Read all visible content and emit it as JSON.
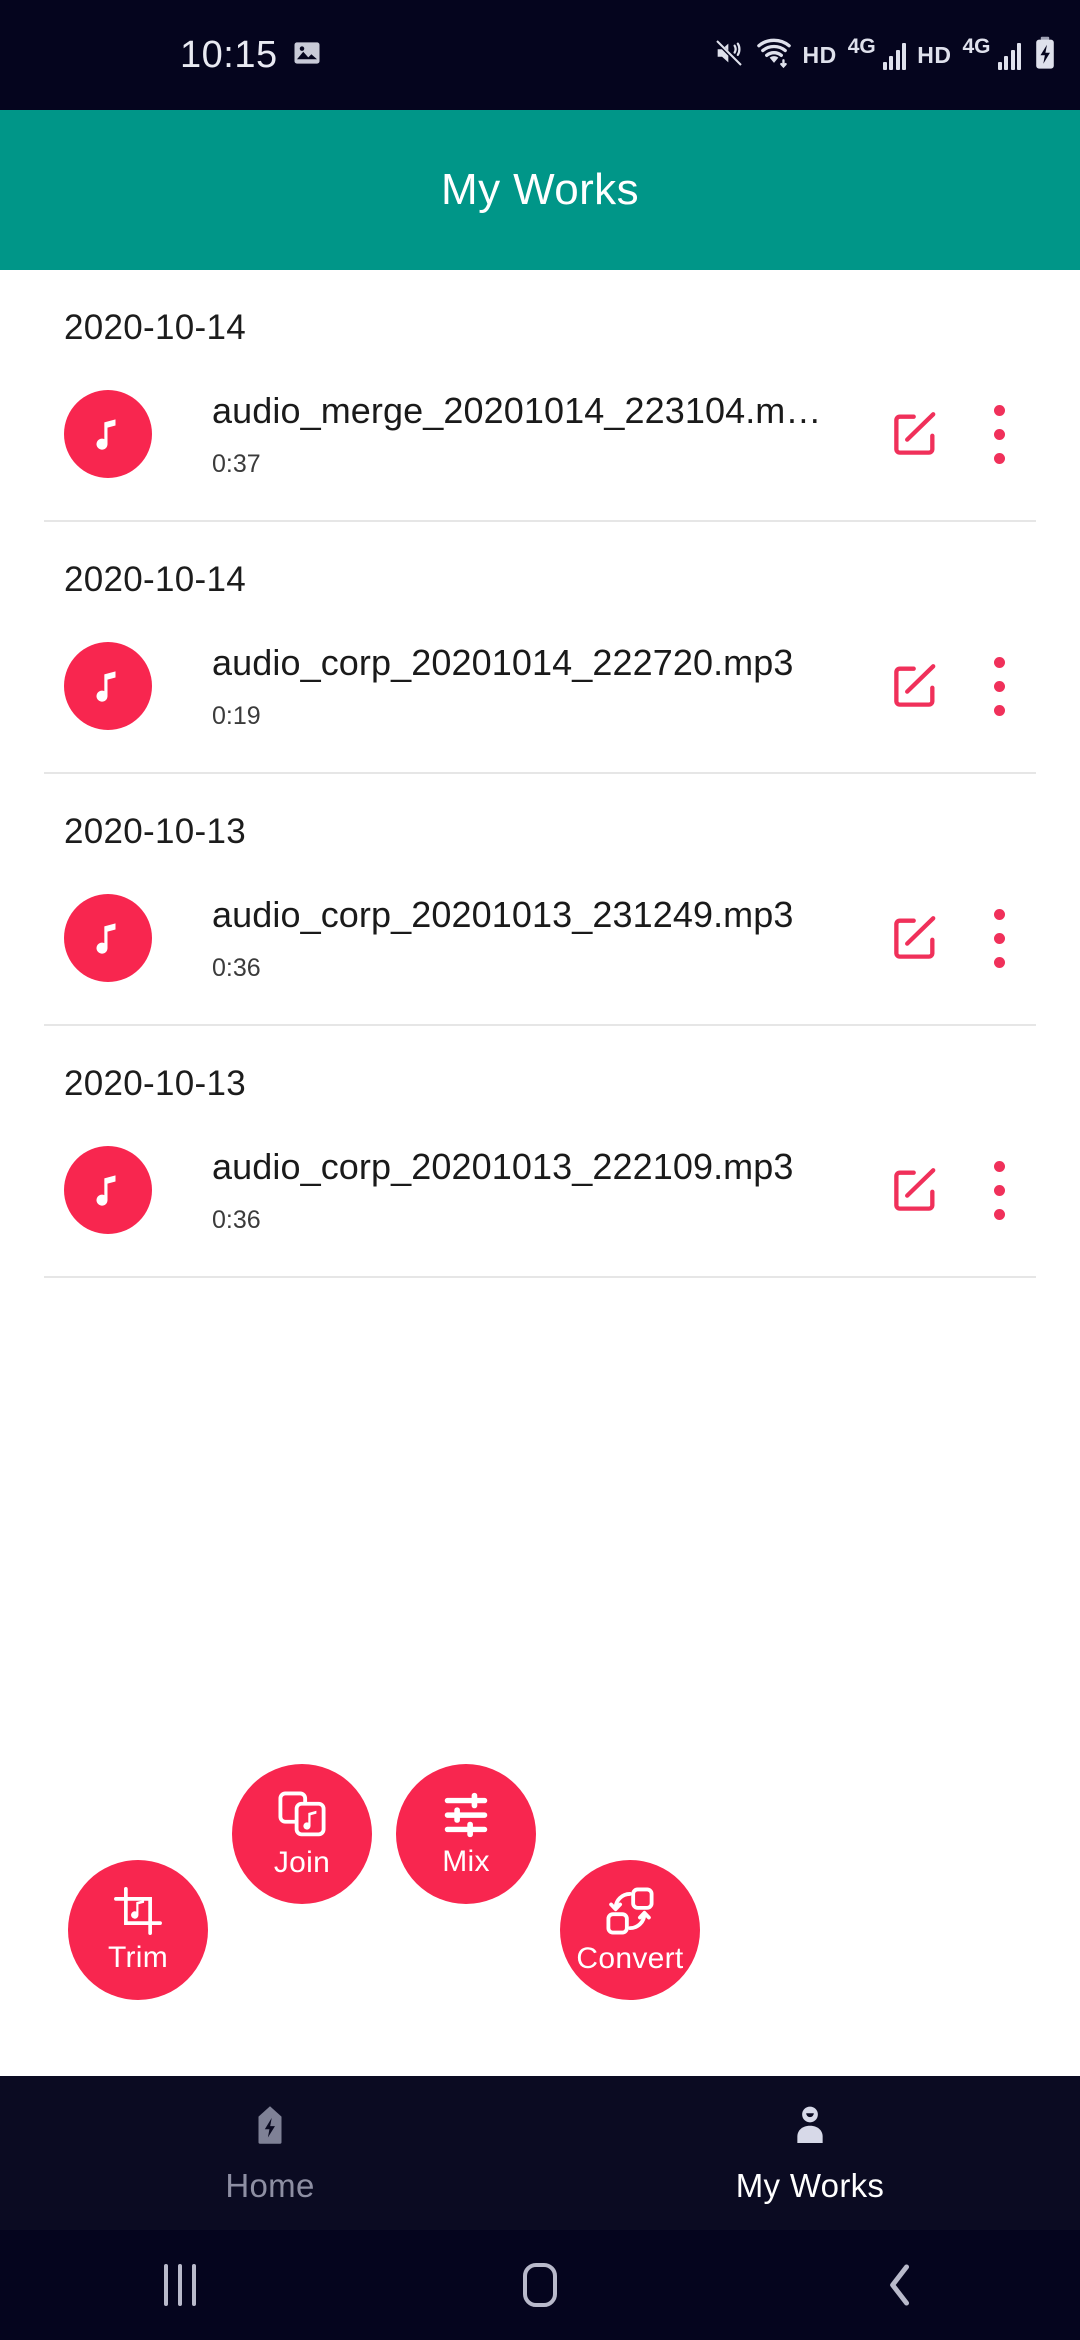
{
  "statusbar": {
    "time": "10:15",
    "icons": [
      "image-icon",
      "mute-vibrate-icon",
      "wifi-icon",
      "hd-icon",
      "4g-signal-icon",
      "hd-icon",
      "4g-signal-icon",
      "battery-charging-icon"
    ],
    "hd_label_1": "HD",
    "network_label_1": "4G",
    "hd_label_2": "HD",
    "network_label_2": "4G"
  },
  "appbar": {
    "title": "My Works",
    "background": "#009688"
  },
  "theme": {
    "accent": "#f8264f",
    "accent_icon": "#f0305a",
    "teal": "#009688",
    "dark": "#05051e",
    "nav_dark": "#0b0b22"
  },
  "list": {
    "items": [
      {
        "date": "2020-10-14",
        "filename": "audio_merge_20201014_223104.m…",
        "duration": "0:37",
        "thumb_icon": "music-note-icon",
        "edit_icon": "edit-icon",
        "more_icon": "more-vertical-icon"
      },
      {
        "date": "2020-10-14",
        "filename": "audio_corp_20201014_222720.mp3",
        "duration": "0:19",
        "thumb_icon": "music-note-icon",
        "edit_icon": "edit-icon",
        "more_icon": "more-vertical-icon"
      },
      {
        "date": "2020-10-13",
        "filename": "audio_corp_20201013_231249.mp3",
        "duration": "0:36",
        "thumb_icon": "music-note-icon",
        "edit_icon": "edit-icon",
        "more_icon": "more-vertical-icon"
      },
      {
        "date": "2020-10-13",
        "filename": "audio_corp_20201013_222109.mp3",
        "duration": "0:36",
        "thumb_icon": "music-note-icon",
        "edit_icon": "edit-icon",
        "more_icon": "more-vertical-icon"
      }
    ]
  },
  "fabs": [
    {
      "label": "Trim",
      "icon": "crop-music-icon"
    },
    {
      "label": "Join",
      "icon": "join-files-icon"
    },
    {
      "label": "Mix",
      "icon": "sliders-icon"
    },
    {
      "label": "Convert",
      "icon": "convert-arrows-icon"
    }
  ],
  "bottom_nav": {
    "items": [
      {
        "label": "Home",
        "icon": "flash-shield-icon",
        "active": false
      },
      {
        "label": "My Works",
        "icon": "person-icon",
        "active": true
      }
    ]
  },
  "system_nav": {
    "recents_icon": "recents-icon",
    "home_icon": "home-square-icon",
    "back_icon": "back-chevron-icon"
  }
}
